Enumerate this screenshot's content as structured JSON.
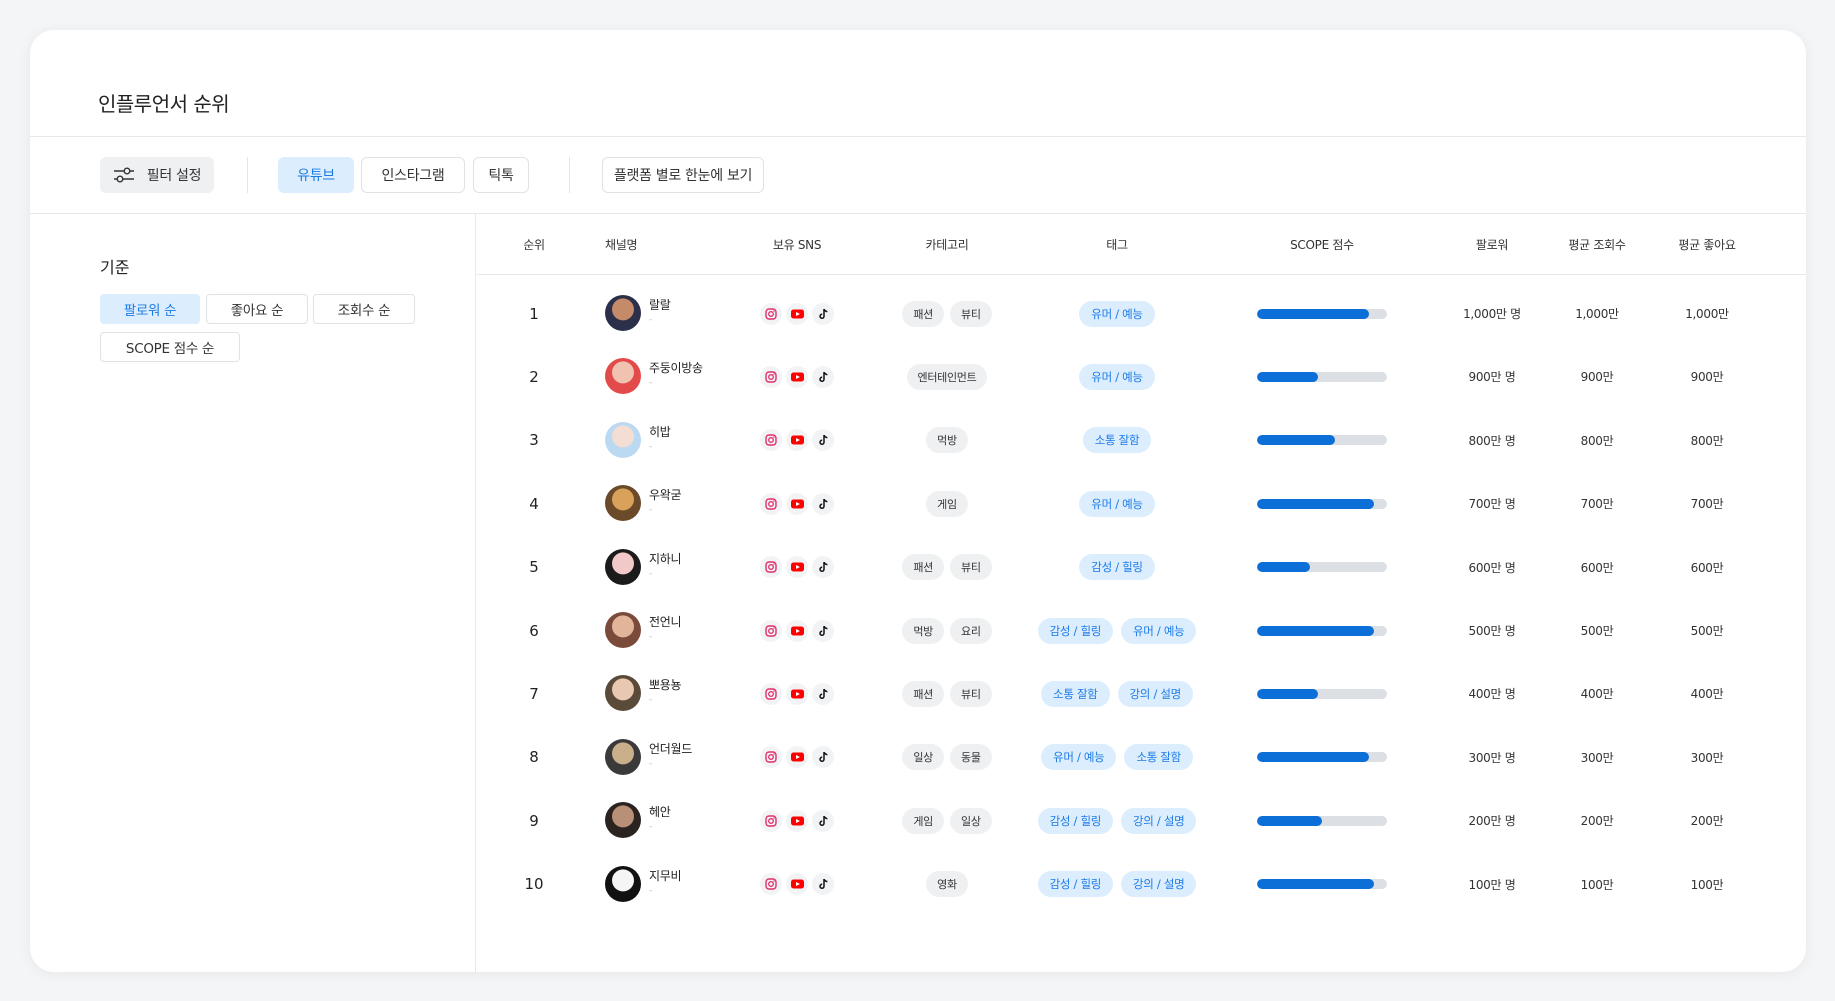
{
  "page": {
    "title": "인플루언서 순위"
  },
  "toolbar": {
    "filter_label": "필터 설정",
    "platform_tabs": [
      "유튜브",
      "인스타그램",
      "틱톡"
    ],
    "active_tab": 0,
    "overview_label": "플랫폼 별로 한눈에 보기"
  },
  "sidebar": {
    "criteria_title": "기준",
    "sort_options": [
      "팔로워 순",
      "좋아요 순",
      "조회수 순",
      "SCOPE 점수 순"
    ],
    "active_sort": 0
  },
  "table": {
    "headers": [
      "순위",
      "채널명",
      "보유 SNS",
      "카테고리",
      "태그",
      "SCOPE 점수",
      "팔로워",
      "평균 조회수",
      "평균 좋아요"
    ],
    "rows": [
      {
        "rank": "1",
        "name": "랄랄",
        "sub": "-",
        "categories": [
          "패션",
          "뷰티"
        ],
        "tags": [
          "유머 / 예능"
        ],
        "score": 0.86,
        "followers": "1,000만 명",
        "views": "1,000만",
        "likes": "1,000만"
      },
      {
        "rank": "2",
        "name": "주둥이방송",
        "sub": "-",
        "categories": [
          "엔터테인먼트"
        ],
        "tags": [
          "유머 / 예능"
        ],
        "score": 0.47,
        "followers": "900만 명",
        "views": "900만",
        "likes": "900만"
      },
      {
        "rank": "3",
        "name": "히밥",
        "sub": "-",
        "categories": [
          "먹방"
        ],
        "tags": [
          "소통 잘함"
        ],
        "score": 0.6,
        "followers": "800만 명",
        "views": "800만",
        "likes": "800만"
      },
      {
        "rank": "4",
        "name": "우왁굳",
        "sub": "-",
        "categories": [
          "게임"
        ],
        "tags": [
          "유머 / 예능"
        ],
        "score": 0.9,
        "followers": "700만 명",
        "views": "700만",
        "likes": "700만"
      },
      {
        "rank": "5",
        "name": "지하니",
        "sub": "-",
        "categories": [
          "패션",
          "뷰티"
        ],
        "tags": [
          "감성 / 힐링"
        ],
        "score": 0.41,
        "followers": "600만 명",
        "views": "600만",
        "likes": "600만"
      },
      {
        "rank": "6",
        "name": "전언니",
        "sub": "-",
        "categories": [
          "먹방",
          "요리"
        ],
        "tags": [
          "감성 / 힐링",
          "유머 / 예능"
        ],
        "score": 0.9,
        "followers": "500만 명",
        "views": "500만",
        "likes": "500만"
      },
      {
        "rank": "7",
        "name": "뽀용뇽",
        "sub": "-",
        "categories": [
          "패션",
          "뷰티"
        ],
        "tags": [
          "소통 잘함",
          "강의 / 설명"
        ],
        "score": 0.47,
        "followers": "400만 명",
        "views": "400만",
        "likes": "400만"
      },
      {
        "rank": "8",
        "name": "언더월드",
        "sub": "-",
        "categories": [
          "일상",
          "동물"
        ],
        "tags": [
          "유머 / 예능",
          "소통 잘함"
        ],
        "score": 0.86,
        "followers": "300만 명",
        "views": "300만",
        "likes": "300만"
      },
      {
        "rank": "9",
        "name": "헤안",
        "sub": "-",
        "categories": [
          "게임",
          "일상"
        ],
        "tags": [
          "감성 / 힐링",
          "강의 / 설명"
        ],
        "score": 0.5,
        "followers": "200만 명",
        "views": "200만",
        "likes": "200만"
      },
      {
        "rank": "10",
        "name": "지무비",
        "sub": "-",
        "categories": [
          "영화"
        ],
        "tags": [
          "감성 / 힐링",
          "강의 / 설명"
        ],
        "score": 0.9,
        "followers": "100만 명",
        "views": "100만",
        "likes": "100만"
      }
    ]
  },
  "icons": {
    "filter": "sliders-icon",
    "instagram": "instagram-icon",
    "youtube": "youtube-icon",
    "tiktok": "tiktok-icon"
  },
  "colors": {
    "accent": "#1d7be6",
    "accent_bg": "#dceefe",
    "score_bar": "#0c6fd8",
    "youtube": "#ff0000"
  }
}
